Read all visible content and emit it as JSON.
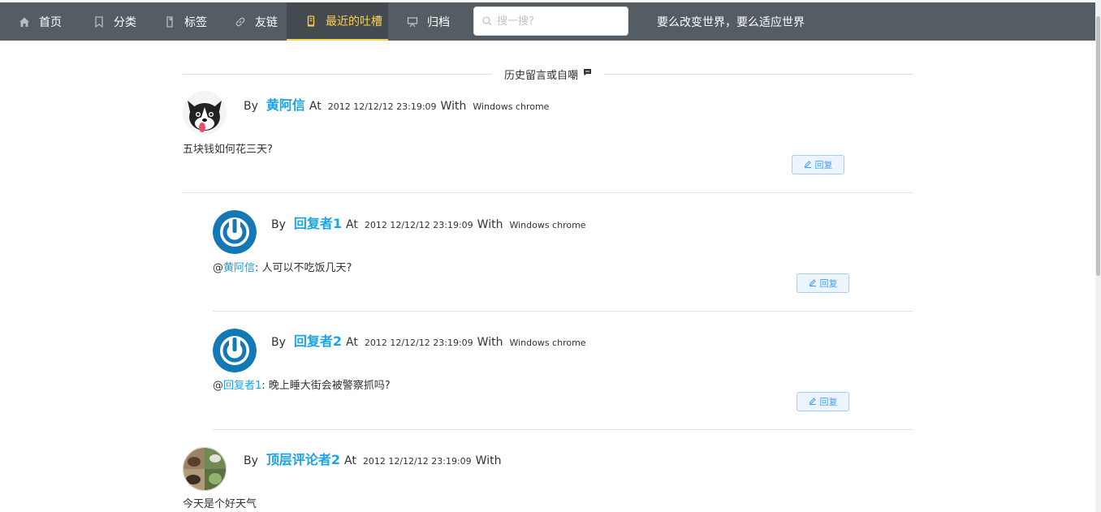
{
  "nav": {
    "items": [
      {
        "label": "首页",
        "icon": "home-icon"
      },
      {
        "label": "分类",
        "icon": "bookmark-icon"
      },
      {
        "label": "标签",
        "icon": "tag-icon"
      },
      {
        "label": "友链",
        "icon": "link-icon"
      },
      {
        "label": "最近的吐槽",
        "icon": "message-icon",
        "active": true
      },
      {
        "label": "归档",
        "icon": "archive-icon"
      }
    ],
    "search_placeholder": "搜一搜?",
    "slogan": "要么改变世界，要么适应世界"
  },
  "section": {
    "title": "历史留言或自嘲"
  },
  "labels": {
    "by": "By",
    "at": "At",
    "with": "With",
    "reply": "回复",
    "at_sign": "@"
  },
  "comments": [
    {
      "author": "黄阿信",
      "time": "2012 12/12/12 23:19:09",
      "client": "Windows chrome",
      "text": "五块钱如何花三天?"
    },
    {
      "author": "回复者1",
      "time": "2012 12/12/12 23:19:09",
      "client": "Windows chrome",
      "reply_to": "黄阿信",
      "text": ": 人可以不吃饭几天?"
    },
    {
      "author": "回复者2",
      "time": "2012 12/12/12 23:19:09",
      "client": "Windows chrome",
      "reply_to": "回复者1",
      "text": ": 晚上睡大街会被警察抓吗?"
    },
    {
      "author": "顶层评论者2",
      "time": "2012 12/12/12 23:19:09",
      "client": "",
      "text": "今天是个好天气"
    }
  ],
  "colors": {
    "nav_bg": "#545c64",
    "active": "#ffd04b",
    "link": "#1aa3e6",
    "button": "#409eff"
  }
}
